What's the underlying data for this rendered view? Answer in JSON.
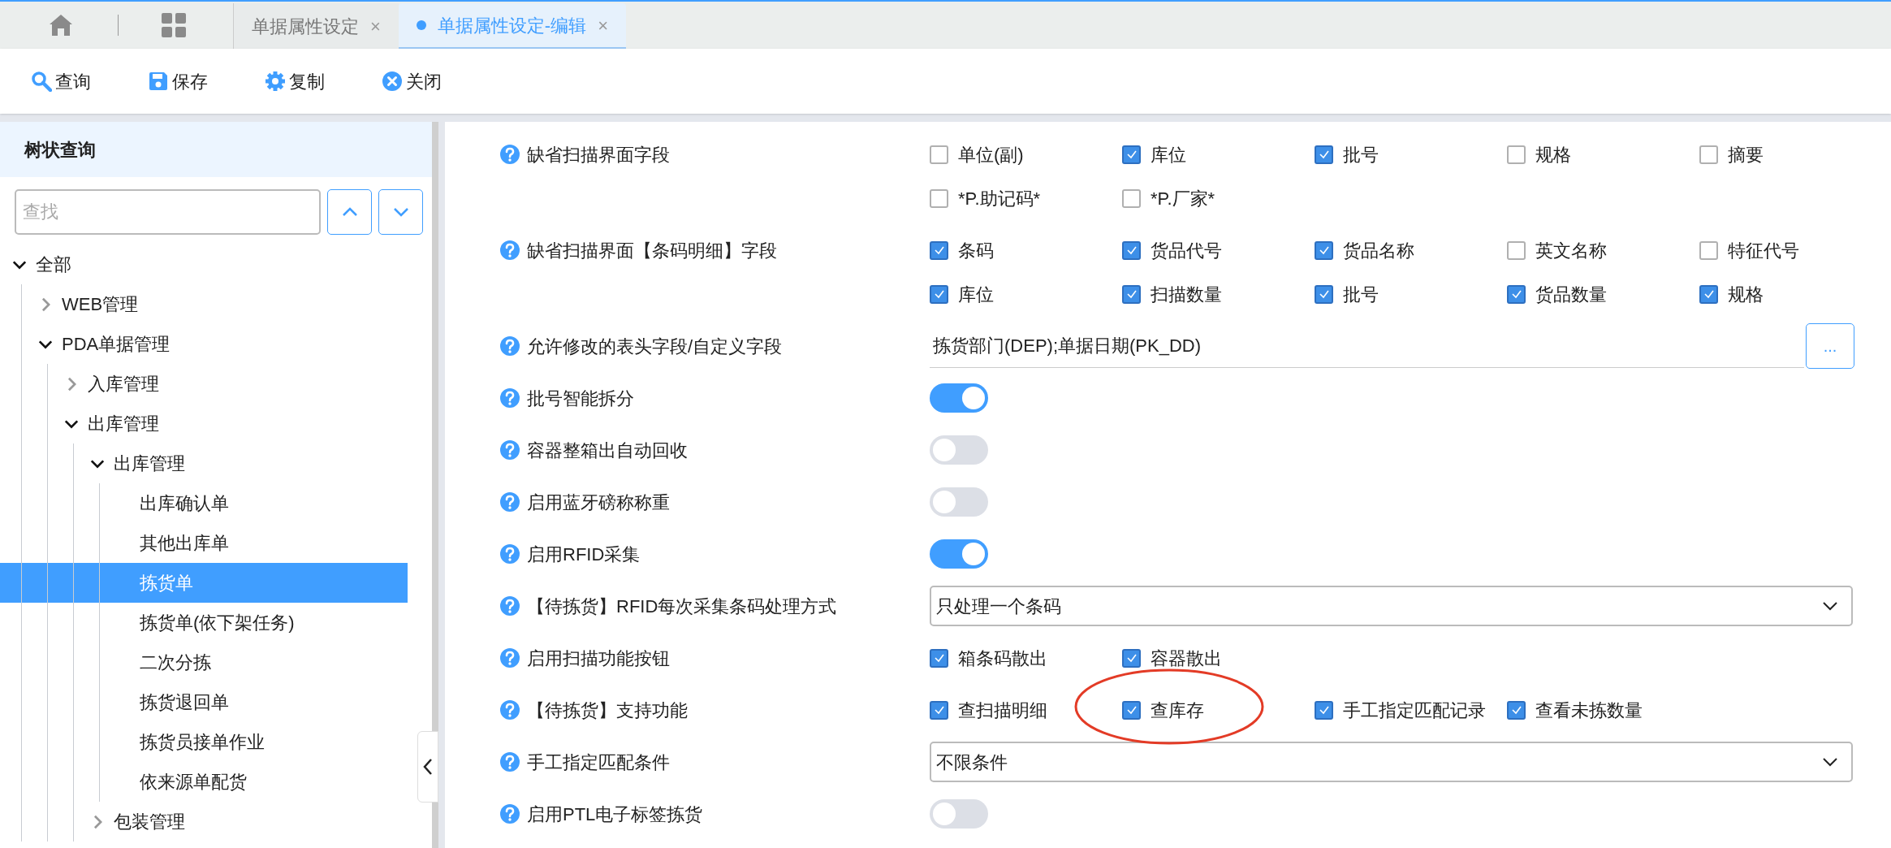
{
  "tabs": [
    {
      "label": "单据属性设定",
      "selected": false,
      "close": "×"
    },
    {
      "label": "单据属性设定-编辑",
      "selected": true,
      "close": "×"
    }
  ],
  "toolbar": [
    {
      "kind": "search",
      "label": "查询"
    },
    {
      "kind": "save",
      "label": "保存"
    },
    {
      "kind": "gear",
      "label": "复制"
    },
    {
      "kind": "close",
      "label": "关闭"
    }
  ],
  "sidebar": {
    "title": "树状查询",
    "search": {
      "placeholder": "查找"
    },
    "tree": [
      {
        "label": "全部",
        "expanded": true,
        "selected": false,
        "children": [
          {
            "label": "WEB管理",
            "expanded": false,
            "selected": false
          },
          {
            "label": "PDA单据管理",
            "expanded": true,
            "selected": false,
            "children": [
              {
                "label": "入库管理",
                "expanded": false,
                "selected": false
              },
              {
                "label": "出库管理",
                "expanded": true,
                "selected": false,
                "children": [
                  {
                    "label": "出库管理",
                    "expanded": true,
                    "selected": false,
                    "children": [
                      {
                        "label": "出库确认单",
                        "selected": false
                      },
                      {
                        "label": "其他出库单",
                        "selected": false
                      },
                      {
                        "label": "拣货单",
                        "selected": true
                      },
                      {
                        "label": "拣货单(依下架任务)",
                        "selected": false
                      },
                      {
                        "label": "二次分拣",
                        "selected": false
                      },
                      {
                        "label": "拣货退回单",
                        "selected": false
                      },
                      {
                        "label": "拣货员接单作业",
                        "selected": false
                      },
                      {
                        "label": "依来源单配货",
                        "selected": false
                      }
                    ]
                  },
                  {
                    "label": "包装管理",
                    "expanded": false,
                    "selected": false
                  }
                ]
              }
            ]
          }
        ]
      }
    ]
  },
  "settings": [
    {
      "kind": "checkboxes",
      "label": "缺省扫描界面字段",
      "option_rows": [
        [
          {
            "label": "单位(副)",
            "checked": false
          },
          {
            "label": "库位",
            "checked": true
          },
          {
            "label": "批号",
            "checked": true
          },
          {
            "label": "规格",
            "checked": false
          },
          {
            "label": "摘要",
            "checked": false
          }
        ],
        [
          {
            "label": "*P.助记码*",
            "checked": false
          },
          {
            "label": "*P.厂家*",
            "checked": false
          }
        ]
      ]
    },
    {
      "kind": "checkboxes",
      "label": "缺省扫描界面【条码明细】字段",
      "option_rows": [
        [
          {
            "label": "条码",
            "checked": true
          },
          {
            "label": "货品代号",
            "checked": true
          },
          {
            "label": "货品名称",
            "checked": true
          },
          {
            "label": "英文名称",
            "checked": false
          },
          {
            "label": "特征代号",
            "checked": false
          }
        ],
        [
          {
            "label": "库位",
            "checked": true
          },
          {
            "label": "扫描数量",
            "checked": true
          },
          {
            "label": "批号",
            "checked": true
          },
          {
            "label": "货品数量",
            "checked": true
          },
          {
            "label": "规格",
            "checked": true
          }
        ]
      ]
    },
    {
      "kind": "text",
      "label": "允许修改的表头字段/自定义字段",
      "value": "拣货部门(DEP);单据日期(PK_DD)",
      "button": "..."
    },
    {
      "kind": "toggle",
      "label": "批号智能拆分",
      "on": true
    },
    {
      "kind": "toggle",
      "label": "容器整箱出自动回收",
      "on": false
    },
    {
      "kind": "toggle",
      "label": "启用蓝牙磅称称重",
      "on": false
    },
    {
      "kind": "toggle",
      "label": "启用RFID采集",
      "on": true
    },
    {
      "kind": "select",
      "label": "【待拣货】RFID每次采集条码处理方式",
      "value": "只处理一个条码"
    },
    {
      "kind": "checkboxes",
      "label": "启用扫描功能按钮",
      "option_rows": [
        [
          {
            "label": "箱条码散出",
            "checked": true
          },
          {
            "label": "容器散出",
            "checked": true
          }
        ]
      ]
    },
    {
      "kind": "checkboxes",
      "label": "【待拣货】支持功能",
      "option_rows": [
        [
          {
            "label": "查扫描明细",
            "checked": true
          },
          {
            "label": "查库存",
            "checked": true,
            "circled": true
          },
          {
            "label": "手工指定匹配记录",
            "checked": true
          },
          {
            "label": "查看未拣数量",
            "checked": true
          }
        ]
      ]
    },
    {
      "kind": "select",
      "label": "手工指定匹配条件",
      "value": "不限条件"
    },
    {
      "kind": "toggle",
      "label": "启用PTL电子标签拣货",
      "on": false
    }
  ]
}
